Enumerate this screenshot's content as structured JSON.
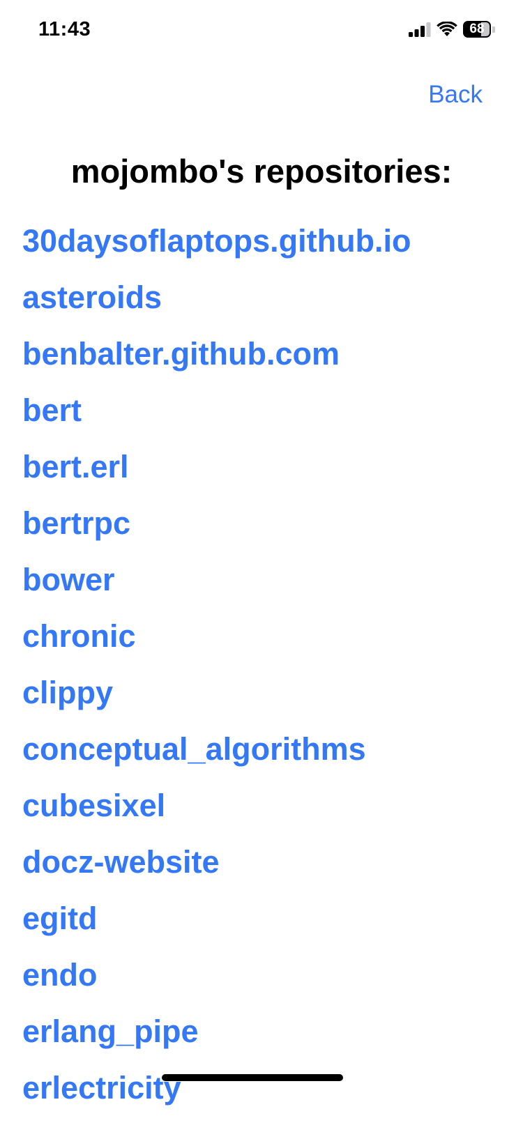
{
  "status_bar": {
    "time": "11:43",
    "battery": "68",
    "battery_level": 0.68,
    "icons": [
      "signal-icon",
      "wifi-icon",
      "battery-icon"
    ]
  },
  "nav": {
    "back_label": "Back"
  },
  "title": "mojombo's repositories:",
  "repositories": [
    "30daysoflaptops.github.io",
    "asteroids",
    "benbalter.github.com",
    "bert",
    "bert.erl",
    "bertrpc",
    "bower",
    "chronic",
    "clippy",
    "conceptual_algorithms",
    "cubesixel",
    "docz-website",
    "egitd",
    "endo",
    "erlang_pipe",
    "erlectricity"
  ],
  "colors": {
    "link": "#3478f6",
    "text": "#000000",
    "background": "#ffffff"
  }
}
